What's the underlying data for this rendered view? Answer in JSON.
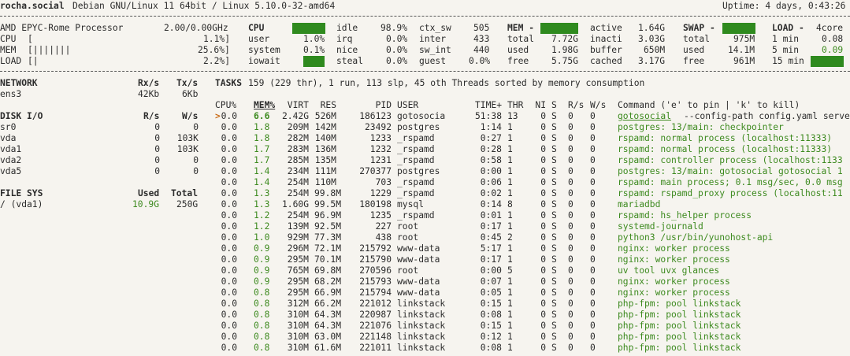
{
  "header": {
    "host": "rocha.social",
    "os": "Debian GNU/Linux 11 64bit / Linux 5.10.0-32-amd64",
    "uptime": "Uptime: 4 days, 0:43:26"
  },
  "quicklook": {
    "cpu_name": "AMD EPYC-Rome Processor",
    "freq": "2.00/0.00GHz",
    "rows": [
      {
        "label": "CPU",
        "bar": "[",
        "pct": "1.1%]"
      },
      {
        "label": "MEM",
        "bar": "[|||||||",
        "pct": "25.6%]"
      },
      {
        "label": "LOAD",
        "bar": "[|",
        "pct": "2.2%]"
      }
    ]
  },
  "cpu": {
    "title": "CPU",
    "total": "1.1%",
    "rows": [
      [
        "user",
        "1.0%",
        "irq",
        "0.0%",
        "inter",
        "433"
      ],
      [
        "system",
        "0.1%",
        "nice",
        "0.0%",
        "sw_int",
        "440"
      ],
      [
        "iowait",
        "0.0%",
        "steal",
        "0.0%",
        "guest",
        "0.0%"
      ]
    ],
    "idle_label": "idle",
    "idle_value": "98.9%",
    "ctx_label": "ctx_sw",
    "ctx_value": "505"
  },
  "mem": {
    "title": "MEM -",
    "pct": "25.6%",
    "rows": [
      [
        "total",
        "7.72G",
        "inacti",
        "3.03G"
      ],
      [
        "used",
        "1.98G",
        "buffer",
        "650M"
      ],
      [
        "free",
        "5.75G",
        "cached",
        "3.17G"
      ]
    ],
    "active_label": "active",
    "active_value": "1.64G"
  },
  "swap": {
    "title": "SWAP -",
    "pct": "1.4%",
    "rows": [
      [
        "total",
        "975M"
      ],
      [
        "used",
        "14.1M"
      ],
      [
        "free",
        "961M"
      ]
    ]
  },
  "load": {
    "title": "LOAD -",
    "cores": "4core",
    "rows": [
      [
        "1 min",
        "0.08"
      ],
      [
        "5 min",
        "0.09"
      ],
      [
        "15 min",
        "0.09"
      ]
    ]
  },
  "network": {
    "title": "NETWORK",
    "rx_header": "Rx/s",
    "tx_header": "Tx/s",
    "rows": [
      [
        "ens3",
        "42Kb",
        "6Kb"
      ]
    ]
  },
  "disk": {
    "title": "DISK I/O",
    "r_header": "R/s",
    "w_header": "W/s",
    "rows": [
      [
        "sr0",
        "0",
        "0"
      ],
      [
        "vda",
        "0",
        "103K"
      ],
      [
        "vda1",
        "0",
        "103K"
      ],
      [
        "vda2",
        "0",
        "0"
      ],
      [
        "vda5",
        "0",
        "0"
      ]
    ]
  },
  "fs": {
    "title": "FILE SYS",
    "used_header": "Used",
    "total_header": "Total",
    "rows": [
      [
        "/ (vda1)",
        "10.9G",
        "250G"
      ]
    ]
  },
  "tasks": {
    "label": "TASKS",
    "summary": "159 (229 thr), 1 run, 113 slp, 45 oth Threads sorted by memory consumption"
  },
  "proc": {
    "headers": {
      "cpu": "CPU%",
      "mem": "MEM%",
      "virt": "VIRT",
      "res": "RES",
      "pid": "PID",
      "user": "USER",
      "time": "TIME+",
      "thr": "THR",
      "ni": "NI",
      "s": "S",
      "rs": "R/s",
      "ws": "W/s",
      "cmd": "Command ('e' to pin | 'k' to kill)"
    },
    "cursor": ">",
    "rows": [
      [
        "0.0",
        "6.6",
        "2.42G",
        "526M",
        "186123",
        "gotosocia",
        "51:38",
        "13",
        "0",
        "S",
        "0",
        "0",
        "gotosocial",
        "--config-path config.yaml serve"
      ],
      [
        "0.0",
        "1.8",
        "209M",
        "142M",
        "23492",
        "postgres",
        "1:14",
        "1",
        "0",
        "S",
        "0",
        "0",
        "postgres: 13/main: checkpointer",
        ""
      ],
      [
        "0.0",
        "1.8",
        "282M",
        "140M",
        "1233",
        "_rspamd",
        "0:27",
        "1",
        "0",
        "S",
        "0",
        "0",
        "rspamd: normal process (localhost:11333)",
        ""
      ],
      [
        "0.0",
        "1.7",
        "283M",
        "136M",
        "1232",
        "_rspamd",
        "0:28",
        "1",
        "0",
        "S",
        "0",
        "0",
        "rspamd: normal process (localhost:11333)",
        ""
      ],
      [
        "0.0",
        "1.7",
        "285M",
        "135M",
        "1231",
        "_rspamd",
        "0:58",
        "1",
        "0",
        "S",
        "0",
        "0",
        "rspamd: controller process (localhost:1133",
        ""
      ],
      [
        "0.0",
        "1.4",
        "234M",
        "111M",
        "270377",
        "postgres",
        "0:00",
        "1",
        "0",
        "S",
        "0",
        "0",
        "postgres: 13/main: gotosocial gotosocial 1",
        ""
      ],
      [
        "0.0",
        "1.4",
        "254M",
        "110M",
        "703",
        "_rspamd",
        "0:06",
        "1",
        "0",
        "S",
        "0",
        "0",
        "rspamd: main process; 0.1 msg/sec, 0.0 msg",
        ""
      ],
      [
        "0.0",
        "1.3",
        "254M",
        "99.8M",
        "1229",
        "_rspamd",
        "0:02",
        "1",
        "0",
        "S",
        "0",
        "0",
        "rspamd: rspamd_proxy process (localhost:11",
        ""
      ],
      [
        "0.0",
        "1.3",
        "1.60G",
        "99.5M",
        "180198",
        "mysql",
        "0:14",
        "8",
        "0",
        "S",
        "0",
        "0",
        "mariadbd",
        ""
      ],
      [
        "0.0",
        "1.2",
        "254M",
        "96.9M",
        "1235",
        "_rspamd",
        "0:01",
        "1",
        "0",
        "S",
        "0",
        "0",
        "rspamd: hs_helper process",
        ""
      ],
      [
        "0.0",
        "1.2",
        "139M",
        "92.5M",
        "227",
        "root",
        "0:17",
        "1",
        "0",
        "S",
        "0",
        "0",
        "systemd-journald",
        ""
      ],
      [
        "0.0",
        "1.0",
        "929M",
        "77.3M",
        "438",
        "root",
        "0:45",
        "2",
        "0",
        "S",
        "0",
        "0",
        "python3 /usr/bin/yunohost-api",
        ""
      ],
      [
        "0.0",
        "0.9",
        "296M",
        "72.1M",
        "215792",
        "www-data",
        "5:17",
        "1",
        "0",
        "S",
        "0",
        "0",
        "nginx: worker process",
        ""
      ],
      [
        "0.0",
        "0.9",
        "295M",
        "70.1M",
        "215790",
        "www-data",
        "0:17",
        "1",
        "0",
        "S",
        "0",
        "0",
        "nginx: worker process",
        ""
      ],
      [
        "0.0",
        "0.9",
        "765M",
        "69.8M",
        "270596",
        "root",
        "0:00",
        "5",
        "0",
        "S",
        "0",
        "0",
        "uv tool uvx glances",
        ""
      ],
      [
        "0.0",
        "0.9",
        "295M",
        "68.2M",
        "215793",
        "www-data",
        "0:07",
        "1",
        "0",
        "S",
        "0",
        "0",
        "nginx: worker process",
        ""
      ],
      [
        "0.0",
        "0.8",
        "295M",
        "66.9M",
        "215794",
        "www-data",
        "0:05",
        "1",
        "0",
        "S",
        "0",
        "0",
        "nginx: worker process",
        ""
      ],
      [
        "0.0",
        "0.8",
        "312M",
        "66.2M",
        "221012",
        "linkstack",
        "0:15",
        "1",
        "0",
        "S",
        "0",
        "0",
        "php-fpm: pool linkstack",
        ""
      ],
      [
        "0.0",
        "0.8",
        "310M",
        "64.3M",
        "220987",
        "linkstack",
        "0:08",
        "1",
        "0",
        "S",
        "0",
        "0",
        "php-fpm: pool linkstack",
        ""
      ],
      [
        "0.0",
        "0.8",
        "310M",
        "64.3M",
        "221076",
        "linkstack",
        "0:15",
        "1",
        "0",
        "S",
        "0",
        "0",
        "php-fpm: pool linkstack",
        ""
      ],
      [
        "0.0",
        "0.8",
        "310M",
        "63.0M",
        "221148",
        "linkstack",
        "0:12",
        "1",
        "0",
        "S",
        "0",
        "0",
        "php-fpm: pool linkstack",
        ""
      ],
      [
        "0.0",
        "0.8",
        "310M",
        "61.6M",
        "221011",
        "linkstack",
        "0:08",
        "1",
        "0",
        "S",
        "0",
        "0",
        "php-fpm: pool linkstack",
        ""
      ]
    ]
  }
}
